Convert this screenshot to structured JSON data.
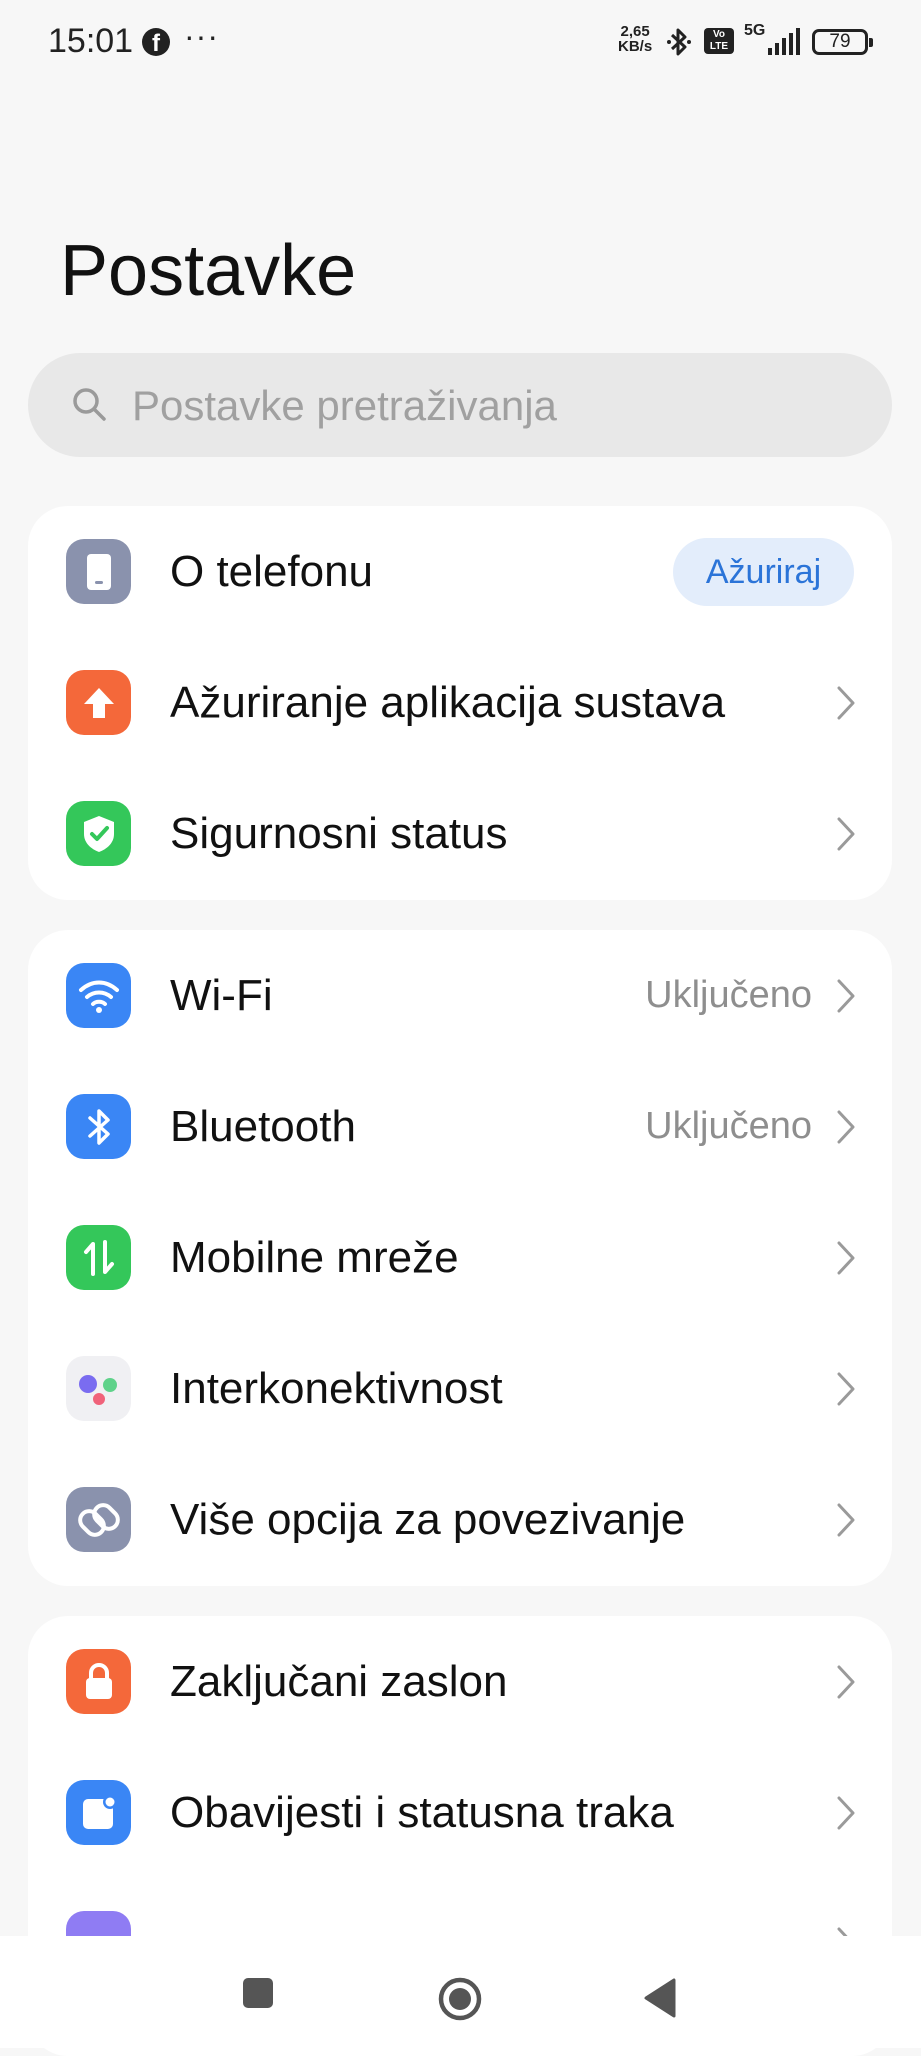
{
  "status_bar": {
    "time": "15:01",
    "facebook_icon": "facebook-icon",
    "more": "···",
    "speed_value": "2,65",
    "speed_unit": "KB/s",
    "volte_top": "Vo",
    "volte_bottom": "LTE",
    "network": "5G",
    "battery": "79"
  },
  "title": "Postavke",
  "search": {
    "placeholder": "Postavke pretraživanja"
  },
  "groups": [
    {
      "items": [
        {
          "label": "O telefonu",
          "icon": "phone-icon",
          "icon_color": "#8a92ad",
          "button": "Ažuriraj"
        },
        {
          "label": "Ažuriranje aplikacija sustava",
          "icon": "arrow-up-icon",
          "icon_color": "#f4683a"
        },
        {
          "label": "Sigurnosni status",
          "icon": "shield-check-icon",
          "icon_color": "#34c75a"
        }
      ]
    },
    {
      "items": [
        {
          "label": "Wi-Fi",
          "icon": "wifi-icon",
          "icon_color": "#3a86f5",
          "value": "Uključeno"
        },
        {
          "label": "Bluetooth",
          "icon": "bluetooth-icon",
          "icon_color": "#3a86f5",
          "value": "Uključeno"
        },
        {
          "label": "Mobilne mreže",
          "icon": "mobile-data-icon",
          "icon_color": "#34c75a"
        },
        {
          "label": "Interkonektivnost",
          "icon": "interconnect-icon",
          "icon_color": "#f0f0f3"
        },
        {
          "label": "Više opcija za povezivanje",
          "icon": "link-icon",
          "icon_color": "#8a92ad"
        }
      ]
    },
    {
      "items": [
        {
          "label": "Zaključani zaslon",
          "icon": "lock-icon",
          "icon_color": "#f4683a"
        },
        {
          "label": "Obavijesti i statusna traka",
          "icon": "notification-icon",
          "icon_color": "#3a86f5"
        }
      ]
    }
  ],
  "nav": {
    "recents": "square-icon",
    "home": "home-circle-icon",
    "back": "back-triangle-icon"
  }
}
